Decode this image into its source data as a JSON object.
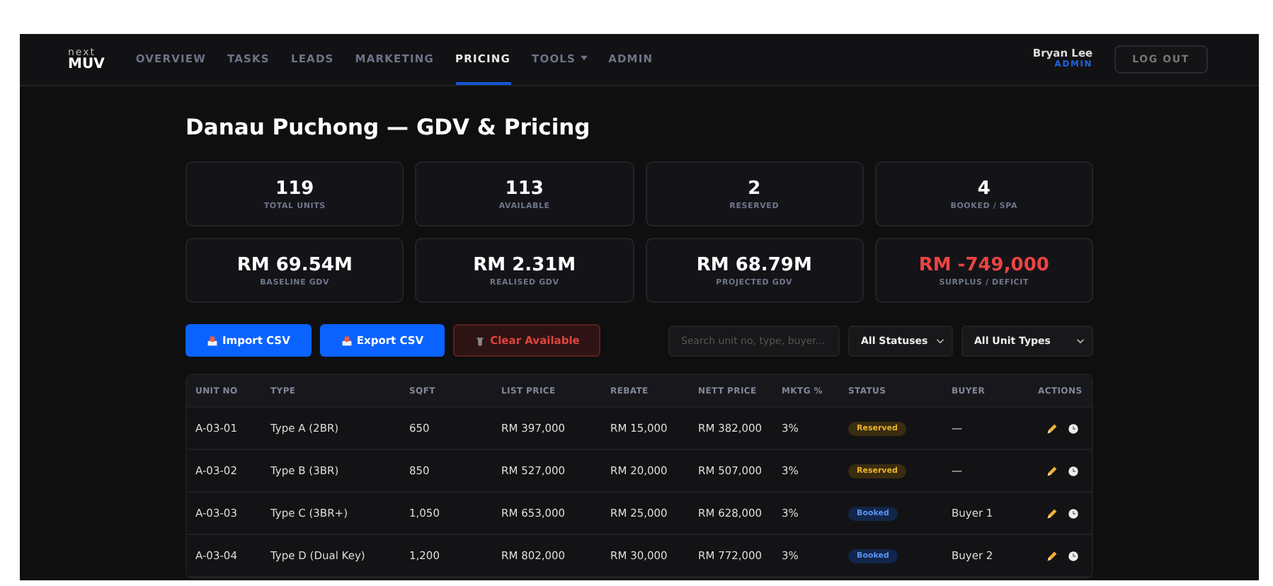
{
  "brand": {
    "top": "next",
    "bottom": "MUV"
  },
  "nav": [
    {
      "label": "OVERVIEW",
      "selected": false,
      "dropdown": false
    },
    {
      "label": "TASKS",
      "selected": false,
      "dropdown": false
    },
    {
      "label": "LEADS",
      "selected": false,
      "dropdown": false
    },
    {
      "label": "MARKETING",
      "selected": false,
      "dropdown": false
    },
    {
      "label": "PRICING",
      "selected": true,
      "dropdown": false
    },
    {
      "label": "TOOLS",
      "selected": false,
      "dropdown": true
    },
    {
      "label": "ADMIN",
      "selected": false,
      "dropdown": false
    }
  ],
  "user": {
    "name": "Bryan Lee",
    "role": "ADMIN"
  },
  "logout": "LOG OUT",
  "title": "Danau Puchong — GDV & Pricing",
  "stats": [
    {
      "value": "119",
      "label": "TOTAL UNITS",
      "negative": false
    },
    {
      "value": "113",
      "label": "AVAILABLE",
      "negative": false
    },
    {
      "value": "2",
      "label": "RESERVED",
      "negative": false
    },
    {
      "value": "4",
      "label": "BOOKED / SPA",
      "negative": false
    },
    {
      "value": "RM 69.54M",
      "label": "BASELINE GDV",
      "negative": false
    },
    {
      "value": "RM 2.31M",
      "label": "REALISED GDV",
      "negative": false
    },
    {
      "value": "RM 68.79M",
      "label": "PROJECTED GDV",
      "negative": false
    },
    {
      "value": "RM -749,000",
      "label": "SURPLUS / DEFICIT",
      "negative": true
    }
  ],
  "actions": [
    {
      "label": "Import CSV",
      "kind": "import"
    },
    {
      "label": "Export CSV",
      "kind": "export"
    },
    {
      "label": "Clear Available",
      "kind": "danger"
    }
  ],
  "search": {
    "placeholder": "Search unit no, type, buyer..."
  },
  "filters": [
    "All Statuses",
    "All Unit Types"
  ],
  "table": {
    "columns": [
      "UNIT NO",
      "TYPE",
      "SQFT",
      "LIST PRICE",
      "REBATE",
      "NETT PRICE",
      "MKTG %",
      "STATUS",
      "BUYER",
      "ACTIONS"
    ],
    "rows": [
      {
        "unit": "A-03-01",
        "type": "Type A (2BR)",
        "sqft": "650",
        "list": "RM 397,000",
        "rebate": "RM 15,000",
        "nett": "RM 382,000",
        "mktg": "3%",
        "status": {
          "label": "Reserved",
          "kind": "reserved"
        },
        "buyer": "—"
      },
      {
        "unit": "A-03-02",
        "type": "Type B (3BR)",
        "sqft": "850",
        "list": "RM 527,000",
        "rebate": "RM 20,000",
        "nett": "RM 507,000",
        "mktg": "3%",
        "status": {
          "label": "Reserved",
          "kind": "reserved"
        },
        "buyer": "—"
      },
      {
        "unit": "A-03-03",
        "type": "Type C (3BR+)",
        "sqft": "1,050",
        "list": "RM 653,000",
        "rebate": "RM 25,000",
        "nett": "RM 628,000",
        "mktg": "3%",
        "status": {
          "label": "Booked",
          "kind": "booked"
        },
        "buyer": "Buyer 1"
      },
      {
        "unit": "A-03-04",
        "type": "Type D (Dual Key)",
        "sqft": "1,200",
        "list": "RM 802,000",
        "rebate": "RM 30,000",
        "nett": "RM 772,000",
        "mktg": "3%",
        "status": {
          "label": "Booked",
          "kind": "booked"
        },
        "buyer": "Buyer 2"
      }
    ]
  }
}
